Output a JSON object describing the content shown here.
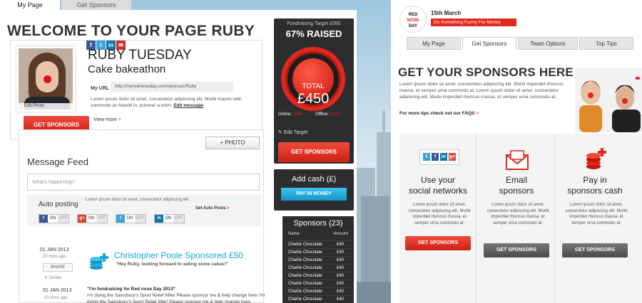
{
  "left": {
    "tabs": [
      "My Page",
      "Get Sponsors"
    ],
    "welcome": "WELCOME TO YOUR PAGE RUBY",
    "profile": {
      "name": "RUBY TUESDAY",
      "event": "Cake bakeathon",
      "url_label": "My URL",
      "url": "http://myrednoseday.com/sponsor/Ruby",
      "bio": "Lorem ipsum dolor sit amet, consectetur adipiscing elit. Morbi mauris velit, commodo ac blandit in, pulvinar a enim.",
      "edit_message": "Edit message",
      "edit_photo": "Edit Photo",
      "get_sponsors": "GET SPONSORS",
      "view_more": "View more",
      "view_more_plus": "+"
    },
    "feed": {
      "photo_button": "+ PHOTO",
      "title": "Message Feed",
      "placeholder": "What's happening?",
      "autopost_title": "Auto posting",
      "autopost_text": "Lorem ipsum dolor sit amet, consectetur adipiscing elit.",
      "on": "ON",
      "off": "OFF",
      "set_auto": "Set Auto Posts",
      "arrow": ">",
      "entry1_date": "01 JAN 2013",
      "entry1_ago": "20 mins ago",
      "share": "SHARE",
      "delete": "Delete",
      "sponsored_title": "Christopher Poole Sponsored £50",
      "sponsored_quote": "\"Hey Ruby, looking forward to eating some cakes!\"",
      "entry2_date": "01 JAN 2013",
      "entry2_ago": "20 mins ago",
      "msg2_bold": "\"I'm fundraising for Red nose Day 2013\"",
      "msg2": "I'm doing the Sainsbury's Sport Relief Mile! Please sponsor me & help change lives I'm doing the Sainsbury's Sport Relief Mile! Please sponsor me & help change lives."
    },
    "fundraising": {
      "target": "Fundraising Target £550",
      "raised": "67% RAISED",
      "raised_fraction": 0.67,
      "total_label": "TOTAL",
      "total": "£450",
      "online_label": "Online:",
      "online": "£250",
      "offline_label": "Offline:",
      "offline": "£200",
      "edit_target": "Edit Target",
      "get_sponsors": "GET SPONSORS"
    },
    "add_cash": {
      "title": "Add cash (£)",
      "button": "PAY IN MONEY"
    },
    "sponsors": {
      "title": "Sponsors (23)",
      "col_name": "Name",
      "col_amount": "Amount",
      "rows": [
        {
          "name": "Charlie Chocolate",
          "amount": "£40"
        },
        {
          "name": "Charlie Chocolate",
          "amount": "£40"
        },
        {
          "name": "Charlie Chocolate",
          "amount": "£40"
        },
        {
          "name": "Charlie Chocolate",
          "amount": "£40"
        },
        {
          "name": "Charlie Chocolate",
          "amount": "£40"
        },
        {
          "name": "Charlie Chocolate",
          "amount": "£40"
        },
        {
          "name": "Charlie Chocolate",
          "amount": "£40"
        },
        {
          "name": "Charlie Chocolate",
          "amount": "£40"
        }
      ]
    }
  },
  "right": {
    "logo_lines": [
      "RED",
      "NOSE",
      "DAY"
    ],
    "date": "15th March",
    "tagline": "Do Something Funny For Money",
    "tabs": [
      "My Page",
      "Get Sponsors",
      "Team Options",
      "Top Tips"
    ],
    "heading": "GET YOUR SPONSORS HERE",
    "intro": "Lorem ipsum dolor sit amet, consectetur adipiscing elit. Morbi imperdiet rhoncus massa, et semper urna commodo at. Lorem ipsum dolor sit amet, consectetur adipiscing elit. Morbi imperdiet rhoncus massa, et semper urna commodo at.",
    "tips": "For more tips check out our FAQS",
    "tips_arrow": ">",
    "columns": [
      {
        "title1": "Use your",
        "title2": "social networks",
        "text": "Lorem ipsum dolor sit amet, consectetur adipiscing elit. Morbi imperdiet rhoncus massa, et semper urna commodo at.",
        "button": "GET SPONSORS"
      },
      {
        "title1": "Email",
        "title2": "sponsors",
        "text": "Lorem ipsum dolor sit amet, consectetur adipiscing elit. Morbi imperdiet rhoncus massa, et semper urna commodo at.",
        "button": "GET SPONSORS"
      },
      {
        "title1": "Pay in",
        "title2": "sponsors cash",
        "text": "Lorem ipsum dolor sit amet, consectetur adipiscing elit. Morbi imperdiet rhoncus massa, et semper urna commodo at.",
        "button": "GET SPONSORS"
      }
    ]
  },
  "colors": {
    "brand_red": "#e0281c",
    "accent_blue": "#1ba3d6",
    "dark": "#2b2d2f"
  }
}
